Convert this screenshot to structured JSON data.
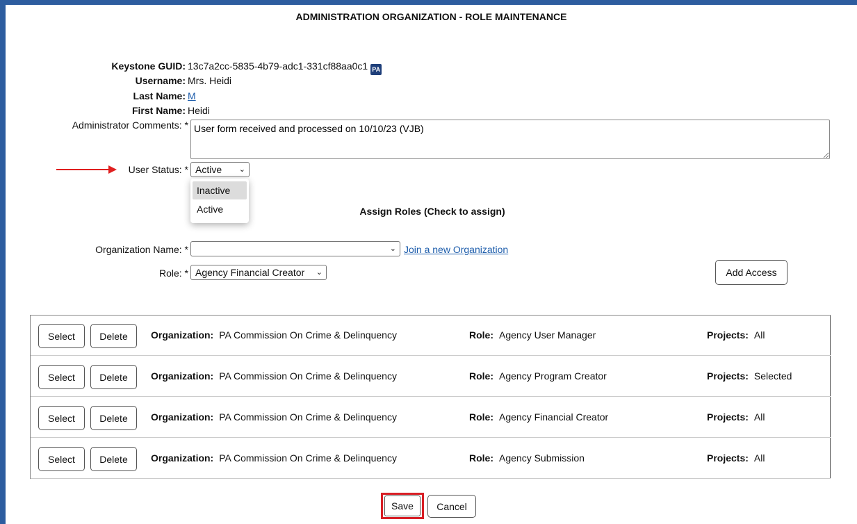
{
  "header": {
    "title": "ADMINISTRATION ORGANIZATION - ROLE MAINTENANCE"
  },
  "user": {
    "guid_label": "Keystone GUID:",
    "guid": "13c7a2cc-5835-4b79-adc1-331cf88aa0c1",
    "username_label": "Username:",
    "username": "Mrs. Heidi",
    "lastname_label": "Last Name:",
    "lastname": "M",
    "firstname_label": "First Name:",
    "firstname": "Heidi",
    "comments_label": "Administrator Comments: *",
    "comments": "User form received and processed on 10/10/23 (VJB)",
    "status_label": "User Status: *",
    "status": "Active",
    "status_options": [
      "Inactive",
      "Active"
    ],
    "badge_text": "PA"
  },
  "assign": {
    "heading": "Assign Roles (Check to assign)",
    "org_label": "Organization Name: *",
    "org_value": "",
    "join_link": "Join a new Organization",
    "role_label": "Role: *",
    "role_value": "Agency Financial Creator",
    "add_access": "Add Access"
  },
  "labels": {
    "select": "Select",
    "delete": "Delete",
    "organization": "Organization:",
    "role": "Role:",
    "projects": "Projects:"
  },
  "roles": [
    {
      "organization": "PA Commission On Crime & Delinquency",
      "role": "Agency User Manager",
      "projects": "All"
    },
    {
      "organization": "PA Commission On Crime & Delinquency",
      "role": "Agency Program Creator",
      "projects": "Selected"
    },
    {
      "organization": "PA Commission On Crime & Delinquency",
      "role": "Agency Financial Creator",
      "projects": "All"
    },
    {
      "organization": "PA Commission On Crime & Delinquency",
      "role": "Agency Submission",
      "projects": "All"
    }
  ],
  "footer": {
    "save": "Save",
    "cancel": "Cancel"
  },
  "colors": {
    "frame": "#2d5d9f",
    "annotation": "#e02020",
    "link": "#1c5cab"
  },
  "icons": {
    "chevron": "chevron-down-icon",
    "arrow": "red-arrow-annotation",
    "badge": "pa-keystone-icon"
  }
}
